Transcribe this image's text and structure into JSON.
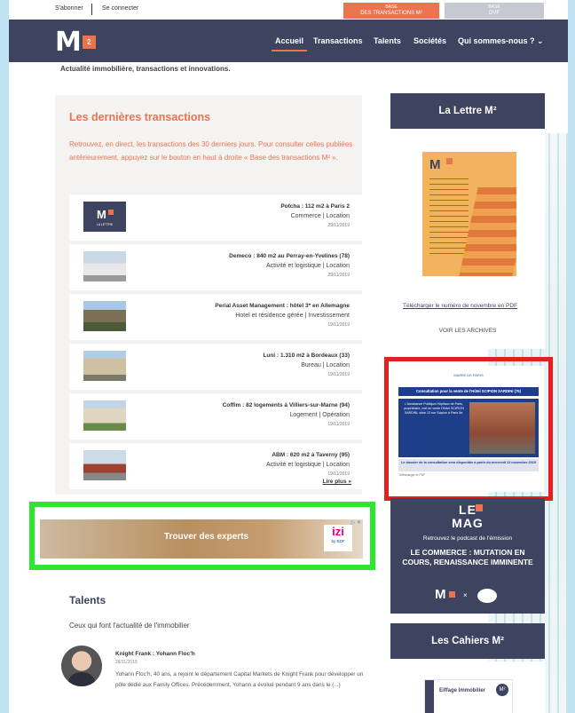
{
  "topbar": {
    "subscribe": "S'abonner",
    "login": "Se connecter",
    "base_tx_small": "BASE",
    "base_tx_label": "DES TRANSACTIONS M²",
    "base_dvf_small": "BASE",
    "base_dvf_label": "DVF"
  },
  "nav": {
    "logo_letter": "M",
    "logo_sup": "2",
    "items": [
      "Accueil",
      "Transactions",
      "Talents",
      "Sociétés",
      "Qui sommes-nous ? ⌄"
    ]
  },
  "tagline": "Actualité immobilière, transactions et innovations.",
  "transactions": {
    "title": "Les dernières transactions",
    "description": "Retrouvez, en direct, les transactions des 30 derniers jours. Pour consulter celles publiées antérieurement, appuyez sur le bouton en haut à droite « Base des transactions M² ».",
    "thumb_logo": "M",
    "thumb_caption": "LA LETTRE",
    "items": [
      {
        "title": "Potcha : 112 m2 à Paris 2",
        "category": "Commerce | Location",
        "date": "29/11/2019"
      },
      {
        "title": "Demeco : 840 m2 au Perray-en-Yvelines (78)",
        "category": "Activité et logistique | Location",
        "date": "29/11/2019"
      },
      {
        "title": "Perial Asset Management : hôtel 3* en Allemagne",
        "category": "Hotel et résidence gérée | Investissement",
        "date": "19/11/2019"
      },
      {
        "title": "Luni : 1.310 m2 à Bordeaux (33)",
        "category": "Bureau | Location",
        "date": "19/11/2019"
      },
      {
        "title": "Coffim : 82 logements à Villiers-sur-Marne (94)",
        "category": "Logement | Opération",
        "date": "19/11/2019"
      },
      {
        "title": "ABM : 620 m2 à Taverny (95)",
        "category": "Activité et logistique | Location",
        "date": "19/11/2019"
      }
    ],
    "more": "Lire plus »"
  },
  "ad_banner": {
    "text": "Trouver des experts",
    "brand": "izi",
    "brand_sub": "by EDF",
    "close": "▷ ✕"
  },
  "talents": {
    "title": "Talents",
    "subtitle": "Ceux qui font l'actualité de l'immobilier",
    "item": {
      "name": "Knight Frank : Yohann Floc'h",
      "date": "28/11/2019",
      "text": "Yohann Floc'h, 40 ans, a rejoint le département Capital Markets de Knight Frank pour développer un pôle dédié aux Family Offices. Précédemment, Yohann a évolué pendant 9 ans dans le (...)"
    }
  },
  "lettre": {
    "title": "La Lettre M²",
    "cover_title": "M",
    "download": "Télécharger le numéro de novembre en PDF",
    "archives": "VOIR LES ARCHIVES"
  },
  "side_ad": {
    "header": "MAIRIE DE PARIS",
    "bar": "Consultation pour la vente de l'Hôtel SCIPION SARDINI (75)",
    "body": "L'Assistance Publique-Hôpitaux de Paris, propriétaire, met en vente l'Hôtel SCIPION SARDINI, situé 13 rue Scipion à Paris 5e.",
    "footer": "Le dossier de la consultation sera disponible à partir du mercredi 13 novembre 2019",
    "footer2": "Télécharger le PDF"
  },
  "lemag": {
    "logo_line1": "LE",
    "logo_line2": "MAG",
    "sub": "Retrouvez le podcast de l'émission",
    "headline": "LE COMMERCE : MUTATION EN COURS, RENAISSANCE IMMINENTE",
    "partner_m": "M",
    "times": "×",
    "radio": "radio"
  },
  "cahiers": {
    "title": "Les Cahiers M²",
    "card_title": "Eiffage Immobilier",
    "card_badge": "M²"
  }
}
